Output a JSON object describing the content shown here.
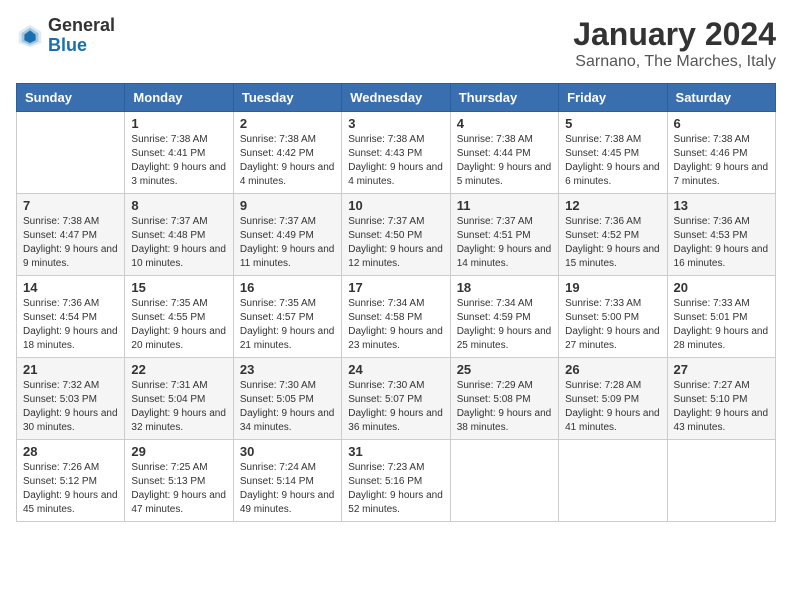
{
  "logo": {
    "general": "General",
    "blue": "Blue"
  },
  "header": {
    "title": "January 2024",
    "subtitle": "Sarnano, The Marches, Italy"
  },
  "weekdays": [
    "Sunday",
    "Monday",
    "Tuesday",
    "Wednesday",
    "Thursday",
    "Friday",
    "Saturday"
  ],
  "weeks": [
    [
      {
        "day": "",
        "sunrise": "",
        "sunset": "",
        "daylight": ""
      },
      {
        "day": "1",
        "sunrise": "Sunrise: 7:38 AM",
        "sunset": "Sunset: 4:41 PM",
        "daylight": "Daylight: 9 hours and 3 minutes."
      },
      {
        "day": "2",
        "sunrise": "Sunrise: 7:38 AM",
        "sunset": "Sunset: 4:42 PM",
        "daylight": "Daylight: 9 hours and 4 minutes."
      },
      {
        "day": "3",
        "sunrise": "Sunrise: 7:38 AM",
        "sunset": "Sunset: 4:43 PM",
        "daylight": "Daylight: 9 hours and 4 minutes."
      },
      {
        "day": "4",
        "sunrise": "Sunrise: 7:38 AM",
        "sunset": "Sunset: 4:44 PM",
        "daylight": "Daylight: 9 hours and 5 minutes."
      },
      {
        "day": "5",
        "sunrise": "Sunrise: 7:38 AM",
        "sunset": "Sunset: 4:45 PM",
        "daylight": "Daylight: 9 hours and 6 minutes."
      },
      {
        "day": "6",
        "sunrise": "Sunrise: 7:38 AM",
        "sunset": "Sunset: 4:46 PM",
        "daylight": "Daylight: 9 hours and 7 minutes."
      }
    ],
    [
      {
        "day": "7",
        "sunrise": "Sunrise: 7:38 AM",
        "sunset": "Sunset: 4:47 PM",
        "daylight": "Daylight: 9 hours and 9 minutes."
      },
      {
        "day": "8",
        "sunrise": "Sunrise: 7:37 AM",
        "sunset": "Sunset: 4:48 PM",
        "daylight": "Daylight: 9 hours and 10 minutes."
      },
      {
        "day": "9",
        "sunrise": "Sunrise: 7:37 AM",
        "sunset": "Sunset: 4:49 PM",
        "daylight": "Daylight: 9 hours and 11 minutes."
      },
      {
        "day": "10",
        "sunrise": "Sunrise: 7:37 AM",
        "sunset": "Sunset: 4:50 PM",
        "daylight": "Daylight: 9 hours and 12 minutes."
      },
      {
        "day": "11",
        "sunrise": "Sunrise: 7:37 AM",
        "sunset": "Sunset: 4:51 PM",
        "daylight": "Daylight: 9 hours and 14 minutes."
      },
      {
        "day": "12",
        "sunrise": "Sunrise: 7:36 AM",
        "sunset": "Sunset: 4:52 PM",
        "daylight": "Daylight: 9 hours and 15 minutes."
      },
      {
        "day": "13",
        "sunrise": "Sunrise: 7:36 AM",
        "sunset": "Sunset: 4:53 PM",
        "daylight": "Daylight: 9 hours and 16 minutes."
      }
    ],
    [
      {
        "day": "14",
        "sunrise": "Sunrise: 7:36 AM",
        "sunset": "Sunset: 4:54 PM",
        "daylight": "Daylight: 9 hours and 18 minutes."
      },
      {
        "day": "15",
        "sunrise": "Sunrise: 7:35 AM",
        "sunset": "Sunset: 4:55 PM",
        "daylight": "Daylight: 9 hours and 20 minutes."
      },
      {
        "day": "16",
        "sunrise": "Sunrise: 7:35 AM",
        "sunset": "Sunset: 4:57 PM",
        "daylight": "Daylight: 9 hours and 21 minutes."
      },
      {
        "day": "17",
        "sunrise": "Sunrise: 7:34 AM",
        "sunset": "Sunset: 4:58 PM",
        "daylight": "Daylight: 9 hours and 23 minutes."
      },
      {
        "day": "18",
        "sunrise": "Sunrise: 7:34 AM",
        "sunset": "Sunset: 4:59 PM",
        "daylight": "Daylight: 9 hours and 25 minutes."
      },
      {
        "day": "19",
        "sunrise": "Sunrise: 7:33 AM",
        "sunset": "Sunset: 5:00 PM",
        "daylight": "Daylight: 9 hours and 27 minutes."
      },
      {
        "day": "20",
        "sunrise": "Sunrise: 7:33 AM",
        "sunset": "Sunset: 5:01 PM",
        "daylight": "Daylight: 9 hours and 28 minutes."
      }
    ],
    [
      {
        "day": "21",
        "sunrise": "Sunrise: 7:32 AM",
        "sunset": "Sunset: 5:03 PM",
        "daylight": "Daylight: 9 hours and 30 minutes."
      },
      {
        "day": "22",
        "sunrise": "Sunrise: 7:31 AM",
        "sunset": "Sunset: 5:04 PM",
        "daylight": "Daylight: 9 hours and 32 minutes."
      },
      {
        "day": "23",
        "sunrise": "Sunrise: 7:30 AM",
        "sunset": "Sunset: 5:05 PM",
        "daylight": "Daylight: 9 hours and 34 minutes."
      },
      {
        "day": "24",
        "sunrise": "Sunrise: 7:30 AM",
        "sunset": "Sunset: 5:07 PM",
        "daylight": "Daylight: 9 hours and 36 minutes."
      },
      {
        "day": "25",
        "sunrise": "Sunrise: 7:29 AM",
        "sunset": "Sunset: 5:08 PM",
        "daylight": "Daylight: 9 hours and 38 minutes."
      },
      {
        "day": "26",
        "sunrise": "Sunrise: 7:28 AM",
        "sunset": "Sunset: 5:09 PM",
        "daylight": "Daylight: 9 hours and 41 minutes."
      },
      {
        "day": "27",
        "sunrise": "Sunrise: 7:27 AM",
        "sunset": "Sunset: 5:10 PM",
        "daylight": "Daylight: 9 hours and 43 minutes."
      }
    ],
    [
      {
        "day": "28",
        "sunrise": "Sunrise: 7:26 AM",
        "sunset": "Sunset: 5:12 PM",
        "daylight": "Daylight: 9 hours and 45 minutes."
      },
      {
        "day": "29",
        "sunrise": "Sunrise: 7:25 AM",
        "sunset": "Sunset: 5:13 PM",
        "daylight": "Daylight: 9 hours and 47 minutes."
      },
      {
        "day": "30",
        "sunrise": "Sunrise: 7:24 AM",
        "sunset": "Sunset: 5:14 PM",
        "daylight": "Daylight: 9 hours and 49 minutes."
      },
      {
        "day": "31",
        "sunrise": "Sunrise: 7:23 AM",
        "sunset": "Sunset: 5:16 PM",
        "daylight": "Daylight: 9 hours and 52 minutes."
      },
      {
        "day": "",
        "sunrise": "",
        "sunset": "",
        "daylight": ""
      },
      {
        "day": "",
        "sunrise": "",
        "sunset": "",
        "daylight": ""
      },
      {
        "day": "",
        "sunrise": "",
        "sunset": "",
        "daylight": ""
      }
    ]
  ]
}
